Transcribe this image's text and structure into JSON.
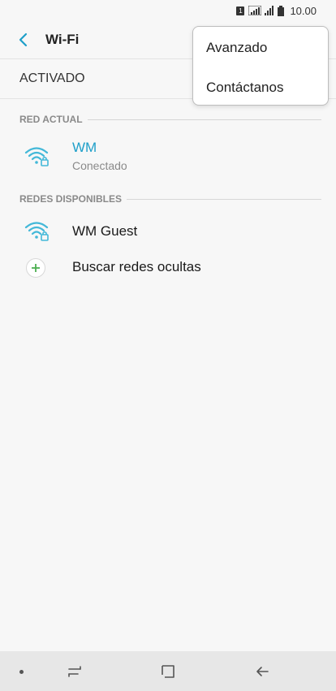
{
  "status_bar": {
    "sim_label": "1",
    "time": "10.00"
  },
  "header": {
    "title": "Wi-Fi"
  },
  "master_switch": {
    "label": "ACTIVADO"
  },
  "current_network": {
    "section_label": "RED ACTUAL",
    "name": "WM",
    "status": "Conectado"
  },
  "available_networks": {
    "section_label": "REDES DISPONIBLES",
    "items": [
      {
        "name": "WM Guest"
      }
    ],
    "hidden_search_label": "Buscar redes ocultas"
  },
  "overflow_menu": {
    "items": [
      {
        "label": "Avanzado"
      },
      {
        "label": "Contáctanos"
      }
    ]
  },
  "colors": {
    "accent": "#1e9fc9",
    "wifi_icon": "#43b8d8",
    "add_green": "#4caf50",
    "background": "#f7f7f7"
  }
}
